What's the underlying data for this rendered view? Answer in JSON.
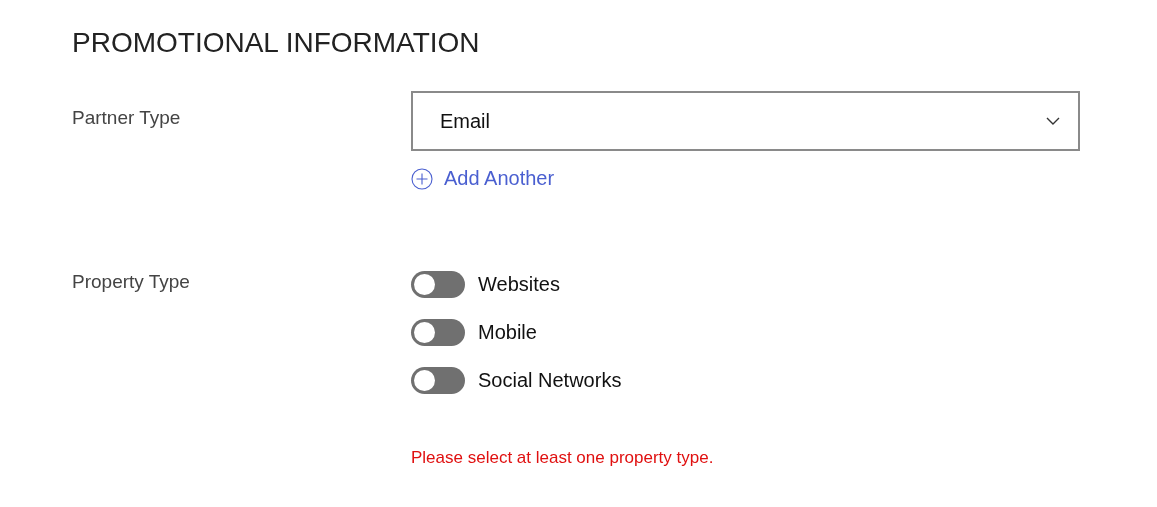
{
  "section_title": "PROMOTIONAL INFORMATION",
  "partner_type": {
    "label": "Partner Type",
    "value": "Email",
    "add_link": "Add Another"
  },
  "property_type": {
    "label": "Property Type",
    "options": [
      {
        "label": "Websites",
        "on": false
      },
      {
        "label": "Mobile",
        "on": false
      },
      {
        "label": "Social Networks",
        "on": false
      }
    ],
    "error": "Please select at least one property type."
  }
}
